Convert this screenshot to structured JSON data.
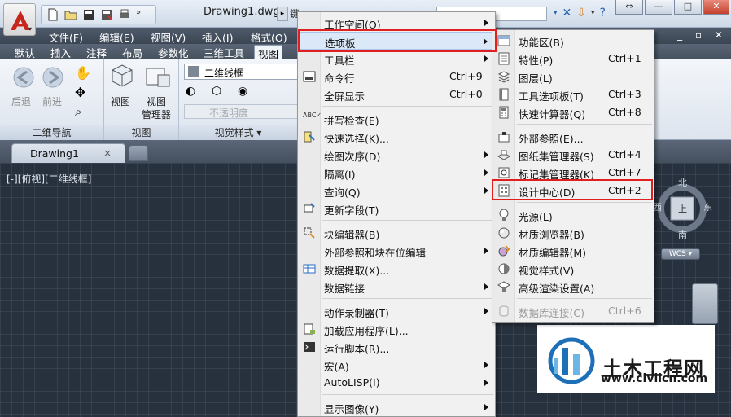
{
  "titlebar": {
    "document_title": "Drawing1.dwg",
    "search_placeholder": "键"
  },
  "menubar": [
    "文件(F)",
    "编辑(E)",
    "视图(V)",
    "插入(I)",
    "格式(O)"
  ],
  "ribbon_tabs": [
    "默认",
    "插入",
    "注释",
    "布局",
    "参数化",
    "三维工具",
    "视图"
  ],
  "ribbon": {
    "nav_panel": {
      "title": "二维导航",
      "back": "后退",
      "forward": "前进"
    },
    "view_panel": {
      "title": "视图",
      "view": "视图",
      "view_manager_1": "视图",
      "view_manager_2": "管理器"
    },
    "visual_panel": {
      "title": "视觉样式",
      "style": "二维线框",
      "transparency": "不透明度"
    }
  },
  "doc_tabs": {
    "active": "Drawing1",
    "close": "×"
  },
  "viewport": {
    "label": "[-][俯视][二维线框]",
    "north": "北",
    "south": "南",
    "east": "东",
    "west": "西",
    "cube_face": "上",
    "wcs": "WCS"
  },
  "tools_menu": {
    "items": [
      {
        "label": "工作空间(O)",
        "shortcut": "",
        "submenu": true
      },
      {
        "label": "选项板",
        "shortcut": "",
        "submenu": true,
        "highlighted": true
      },
      {
        "label": "工具栏",
        "shortcut": "",
        "submenu": true
      },
      {
        "label": "命令行",
        "shortcut": "Ctrl+9",
        "submenu": false
      },
      {
        "label": "全屏显示",
        "shortcut": "Ctrl+0",
        "submenu": false
      },
      {
        "label": "拼写检查(E)",
        "shortcut": "",
        "submenu": false
      },
      {
        "label": "快速选择(K)...",
        "shortcut": "",
        "submenu": false
      },
      {
        "label": "绘图次序(D)",
        "shortcut": "",
        "submenu": true
      },
      {
        "label": "隔离(I)",
        "shortcut": "",
        "submenu": true
      },
      {
        "label": "查询(Q)",
        "shortcut": "",
        "submenu": true
      },
      {
        "label": "更新字段(T)",
        "shortcut": "",
        "submenu": false
      },
      {
        "label": "块编辑器(B)",
        "shortcut": "",
        "submenu": false
      },
      {
        "label": "外部参照和块在位编辑",
        "shortcut": "",
        "submenu": true
      },
      {
        "label": "数据提取(X)...",
        "shortcut": "",
        "submenu": false
      },
      {
        "label": "数据链接",
        "shortcut": "",
        "submenu": true
      },
      {
        "label": "动作录制器(T)",
        "shortcut": "",
        "submenu": true
      },
      {
        "label": "加载应用程序(L)...",
        "shortcut": "",
        "submenu": false
      },
      {
        "label": "运行脚本(R)...",
        "shortcut": "",
        "submenu": false
      },
      {
        "label": "宏(A)",
        "shortcut": "",
        "submenu": true
      },
      {
        "label": "AutoLISP(I)",
        "shortcut": "",
        "submenu": true
      },
      {
        "label": "显示图像(Y)",
        "shortcut": "",
        "submenu": true
      }
    ]
  },
  "palettes_menu": {
    "items": [
      {
        "label": "功能区(B)",
        "shortcut": ""
      },
      {
        "label": "特性(P)",
        "shortcut": "Ctrl+1"
      },
      {
        "label": "图层(L)",
        "shortcut": ""
      },
      {
        "label": "工具选项板(T)",
        "shortcut": "Ctrl+3"
      },
      {
        "label": "快速计算器(Q)",
        "shortcut": "Ctrl+8"
      },
      {
        "label": "外部参照(E)...",
        "shortcut": ""
      },
      {
        "label": "图纸集管理器(S)",
        "shortcut": "Ctrl+4"
      },
      {
        "label": "标记集管理器(K)",
        "shortcut": "Ctrl+7"
      },
      {
        "label": "设计中心(D)",
        "shortcut": "Ctrl+2",
        "highlighted": true
      },
      {
        "label": "光源(L)",
        "shortcut": ""
      },
      {
        "label": "材质浏览器(B)",
        "shortcut": ""
      },
      {
        "label": "材质编辑器(M)",
        "shortcut": ""
      },
      {
        "label": "视觉样式(V)",
        "shortcut": ""
      },
      {
        "label": "高级渲染设置(A)",
        "shortcut": ""
      },
      {
        "label": "数据库连接(C)",
        "shortcut": "Ctrl+6",
        "disabled": true
      }
    ]
  },
  "watermark": {
    "name": "土木工程网",
    "url": "www.civilcn.com"
  },
  "colors": {
    "highlight_box": "#e02020",
    "menu_bg": "#f1f1f1",
    "canvas_bg": "#27303d"
  }
}
